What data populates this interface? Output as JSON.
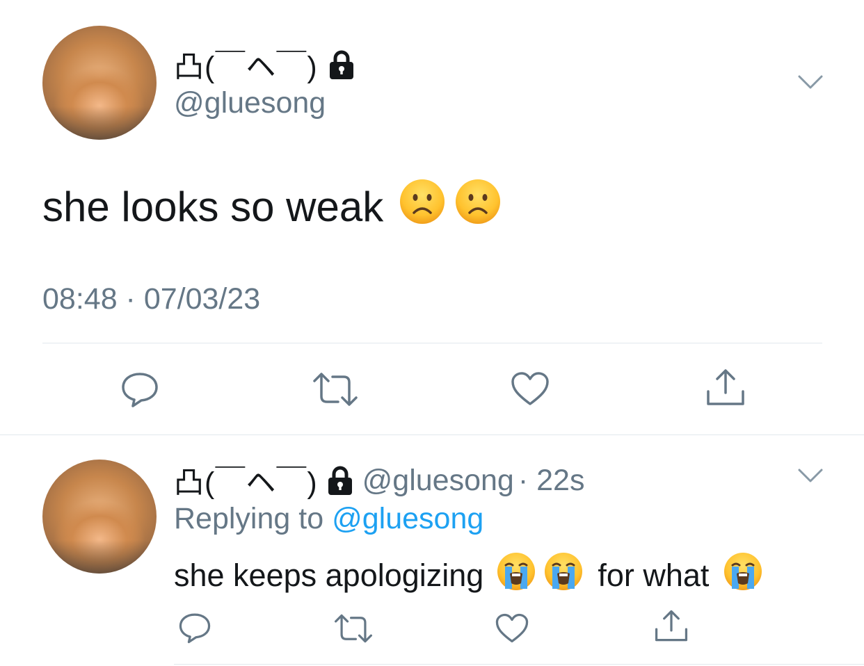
{
  "main_tweet": {
    "display_name": "凸(￣ヘ￣)",
    "handle": "@gluesong",
    "text": "she looks so weak",
    "emojis": [
      "frowning-face-emoji",
      "frowning-face-emoji"
    ],
    "timestamp": "08:48 · 07/03/23",
    "actions": [
      "reply-icon",
      "retweet-icon",
      "like-icon",
      "share-icon"
    ]
  },
  "reply_tweet": {
    "display_name": "凸(￣ヘ￣)",
    "handle": "@gluesong",
    "age": "· 22s",
    "replying_prefix": "Replying to",
    "replying_handle": "@gluesong",
    "text_part1": "she keeps apologizing",
    "text_part2": "for what",
    "emojis": [
      "loudly-crying-face-emoji",
      "loudly-crying-face-emoji",
      "loudly-crying-face-emoji"
    ],
    "actions": [
      "reply-icon",
      "retweet-icon",
      "like-icon",
      "share-icon"
    ]
  },
  "colors": {
    "text": "#14171a",
    "secondary": "#657786",
    "link": "#1da1f2",
    "divider": "#e1e8ed"
  }
}
